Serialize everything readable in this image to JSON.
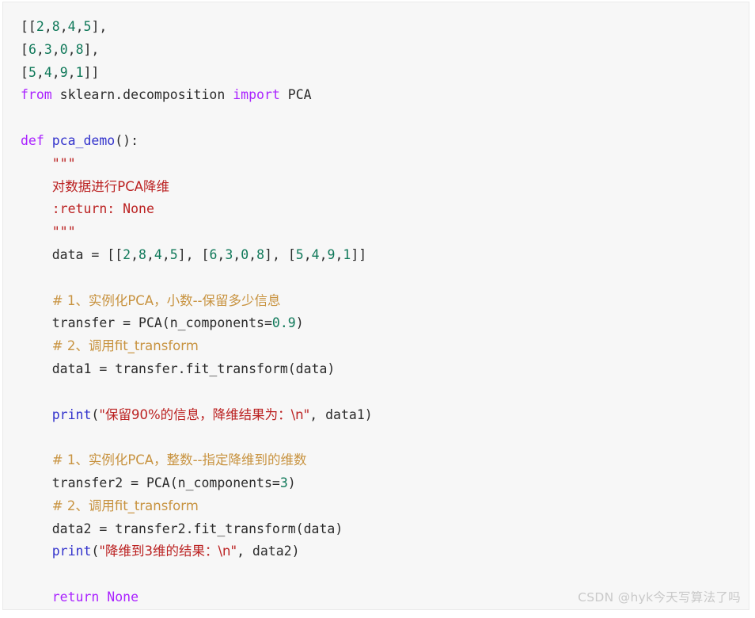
{
  "page": {
    "type": "code-snippet-screenshot",
    "background_color": "#ffffff",
    "code_block_background": "#f7f7f7",
    "code_block_border_color": "#eaeaea",
    "language": "python"
  },
  "theme_colors": {
    "keyword": "#aa22ff",
    "function": "#3333cc",
    "number": "#10795a",
    "string": "#bb2222",
    "comment": "#c89340",
    "plain_text": "#2b2b2b",
    "watermark": "#c9c9c9"
  },
  "code": {
    "lines": [
      {
        "tokens": [
          {
            "t": "[[",
            "c": "pl"
          },
          {
            "t": "2",
            "c": "num"
          },
          {
            "t": ",",
            "c": "pl"
          },
          {
            "t": "8",
            "c": "num"
          },
          {
            "t": ",",
            "c": "pl"
          },
          {
            "t": "4",
            "c": "num"
          },
          {
            "t": ",",
            "c": "pl"
          },
          {
            "t": "5",
            "c": "num"
          },
          {
            "t": "],",
            "c": "pl"
          }
        ]
      },
      {
        "tokens": [
          {
            "t": "[",
            "c": "pl"
          },
          {
            "t": "6",
            "c": "num"
          },
          {
            "t": ",",
            "c": "pl"
          },
          {
            "t": "3",
            "c": "num"
          },
          {
            "t": ",",
            "c": "pl"
          },
          {
            "t": "0",
            "c": "num"
          },
          {
            "t": ",",
            "c": "pl"
          },
          {
            "t": "8",
            "c": "num"
          },
          {
            "t": "],",
            "c": "pl"
          }
        ]
      },
      {
        "tokens": [
          {
            "t": "[",
            "c": "pl"
          },
          {
            "t": "5",
            "c": "num"
          },
          {
            "t": ",",
            "c": "pl"
          },
          {
            "t": "4",
            "c": "num"
          },
          {
            "t": ",",
            "c": "pl"
          },
          {
            "t": "9",
            "c": "num"
          },
          {
            "t": ",",
            "c": "pl"
          },
          {
            "t": "1",
            "c": "num"
          },
          {
            "t": "]]",
            "c": "pl"
          }
        ]
      },
      {
        "tokens": [
          {
            "t": "from",
            "c": "kw"
          },
          {
            "t": " sklearn.decomposition ",
            "c": "pl"
          },
          {
            "t": "import",
            "c": "kw"
          },
          {
            "t": " PCA",
            "c": "pl"
          }
        ]
      },
      {
        "tokens": []
      },
      {
        "tokens": [
          {
            "t": "def",
            "c": "kw"
          },
          {
            "t": " ",
            "c": "pl"
          },
          {
            "t": "pca_demo",
            "c": "fn"
          },
          {
            "t": "():",
            "c": "pl"
          }
        ]
      },
      {
        "tokens": [
          {
            "t": "    \"\"\"",
            "c": "str"
          }
        ]
      },
      {
        "tokens": [
          {
            "t": "    ",
            "c": "pl"
          },
          {
            "t": "对数据进行PCA降维",
            "c": "str",
            "cjk": true
          }
        ]
      },
      {
        "tokens": [
          {
            "t": "    :return: None",
            "c": "str"
          }
        ]
      },
      {
        "tokens": [
          {
            "t": "    \"\"\"",
            "c": "str"
          }
        ]
      },
      {
        "tokens": [
          {
            "t": "    data = [[",
            "c": "pl"
          },
          {
            "t": "2",
            "c": "num"
          },
          {
            "t": ",",
            "c": "pl"
          },
          {
            "t": "8",
            "c": "num"
          },
          {
            "t": ",",
            "c": "pl"
          },
          {
            "t": "4",
            "c": "num"
          },
          {
            "t": ",",
            "c": "pl"
          },
          {
            "t": "5",
            "c": "num"
          },
          {
            "t": "], [",
            "c": "pl"
          },
          {
            "t": "6",
            "c": "num"
          },
          {
            "t": ",",
            "c": "pl"
          },
          {
            "t": "3",
            "c": "num"
          },
          {
            "t": ",",
            "c": "pl"
          },
          {
            "t": "0",
            "c": "num"
          },
          {
            "t": ",",
            "c": "pl"
          },
          {
            "t": "8",
            "c": "num"
          },
          {
            "t": "], [",
            "c": "pl"
          },
          {
            "t": "5",
            "c": "num"
          },
          {
            "t": ",",
            "c": "pl"
          },
          {
            "t": "4",
            "c": "num"
          },
          {
            "t": ",",
            "c": "pl"
          },
          {
            "t": "9",
            "c": "num"
          },
          {
            "t": ",",
            "c": "pl"
          },
          {
            "t": "1",
            "c": "num"
          },
          {
            "t": "]]",
            "c": "pl"
          }
        ]
      },
      {
        "tokens": []
      },
      {
        "tokens": [
          {
            "t": "    ",
            "c": "pl"
          },
          {
            "t": "# 1、实例化PCA，小数--保留多少信息",
            "c": "cmt",
            "cjk": true
          }
        ]
      },
      {
        "tokens": [
          {
            "t": "    transfer = PCA(n_components=",
            "c": "pl"
          },
          {
            "t": "0.9",
            "c": "num"
          },
          {
            "t": ")",
            "c": "pl"
          }
        ]
      },
      {
        "tokens": [
          {
            "t": "    ",
            "c": "pl"
          },
          {
            "t": "# 2、调用fit_transform",
            "c": "cmt",
            "cjk": true
          }
        ]
      },
      {
        "tokens": [
          {
            "t": "    data1 = transfer.fit_transform(data)",
            "c": "pl"
          }
        ]
      },
      {
        "tokens": []
      },
      {
        "tokens": [
          {
            "t": "    ",
            "c": "pl"
          },
          {
            "t": "print",
            "c": "fn"
          },
          {
            "t": "(",
            "c": "pl"
          },
          {
            "t": "\"保留90%的信息，降维结果为：\\n\"",
            "c": "str",
            "cjk": true
          },
          {
            "t": ", data1)",
            "c": "pl"
          }
        ]
      },
      {
        "tokens": []
      },
      {
        "tokens": [
          {
            "t": "    ",
            "c": "pl"
          },
          {
            "t": "# 1、实例化PCA，整数--指定降维到的维数",
            "c": "cmt",
            "cjk": true
          }
        ]
      },
      {
        "tokens": [
          {
            "t": "    transfer2 = PCA(n_components=",
            "c": "pl"
          },
          {
            "t": "3",
            "c": "num"
          },
          {
            "t": ")",
            "c": "pl"
          }
        ]
      },
      {
        "tokens": [
          {
            "t": "    ",
            "c": "pl"
          },
          {
            "t": "# 2、调用fit_transform",
            "c": "cmt",
            "cjk": true
          }
        ]
      },
      {
        "tokens": [
          {
            "t": "    data2 = transfer2.fit_transform(data)",
            "c": "pl"
          }
        ]
      },
      {
        "tokens": [
          {
            "t": "    ",
            "c": "pl"
          },
          {
            "t": "print",
            "c": "fn"
          },
          {
            "t": "(",
            "c": "pl"
          },
          {
            "t": "\"降维到3维的结果：\\n\"",
            "c": "str",
            "cjk": true
          },
          {
            "t": ", data2)",
            "c": "pl"
          }
        ]
      },
      {
        "tokens": []
      },
      {
        "tokens": [
          {
            "t": "    ",
            "c": "pl"
          },
          {
            "t": "return",
            "c": "kw"
          },
          {
            "t": " ",
            "c": "pl"
          },
          {
            "t": "None",
            "c": "bi"
          }
        ]
      }
    ]
  },
  "watermark": {
    "text": "CSDN @hyk今天写算法了吗"
  }
}
